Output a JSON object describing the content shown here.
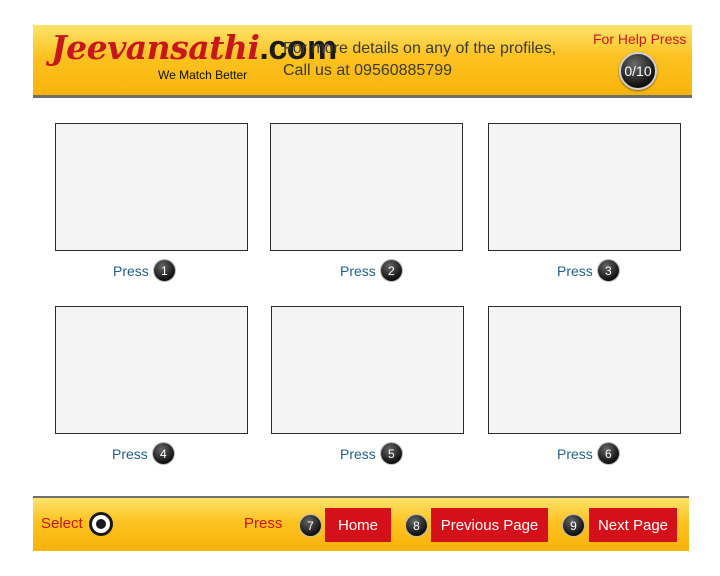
{
  "header": {
    "logo_brand": "Jeevansathi",
    "logo_tld": ".com",
    "tagline": "We Match Better",
    "info_line1": "For more details on any of the profiles,",
    "info_line2": "Call us at 09560885799",
    "help_text": "For Help Press",
    "help_badge": "0/10"
  },
  "profiles": [
    {
      "press": "Press",
      "num": "1"
    },
    {
      "press": "Press",
      "num": "2"
    },
    {
      "press": "Press",
      "num": "3"
    },
    {
      "press": "Press",
      "num": "4"
    },
    {
      "press": "Press",
      "num": "5"
    },
    {
      "press": "Press",
      "num": "6"
    }
  ],
  "footer": {
    "select_label": "Select",
    "press_label": "Press",
    "home_num": "7",
    "home_label": "Home",
    "prev_num": "8",
    "prev_label": "Previous Page",
    "next_num": "9",
    "next_label": "Next Page"
  },
  "colors": {
    "accent_red": "#d4101a",
    "header_gold": "#fcc221",
    "link_blue": "#1f5f8b"
  }
}
